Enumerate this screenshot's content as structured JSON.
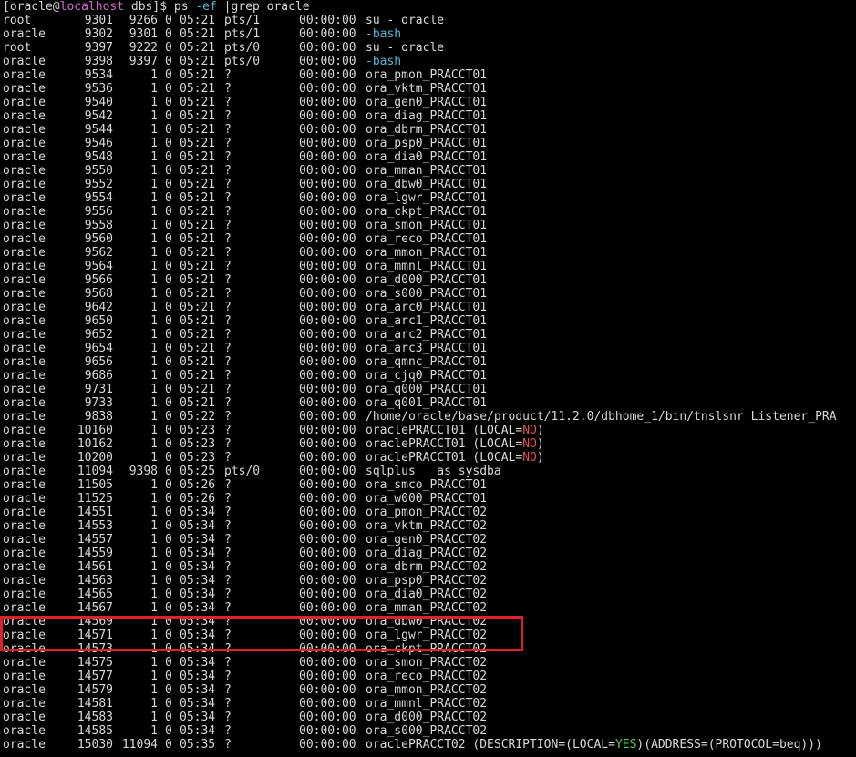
{
  "terminal": {
    "prompt": {
      "open": "[",
      "user": "oracle",
      "at": "@",
      "host": "localhost",
      "dir": " dbs]$ ",
      "cmd": "ps",
      "opt": " -ef",
      "rest": " |grep oracle"
    },
    "rows": [
      {
        "uid": "root",
        "pid": "9301",
        "ppid": "9266",
        "c": "0",
        "stime": "05:21",
        "tty": "pts/1",
        "time": "00:00:00",
        "cmd": "su - oracle"
      },
      {
        "uid": "oracle",
        "pid": "9302",
        "ppid": "9301",
        "c": "0",
        "stime": "05:21",
        "tty": "pts/1",
        "time": "00:00:00",
        "cmd": "-bash",
        "cmd_color": "bash"
      },
      {
        "uid": "root",
        "pid": "9397",
        "ppid": "9222",
        "c": "0",
        "stime": "05:21",
        "tty": "pts/0",
        "time": "00:00:00",
        "cmd": "su - oracle"
      },
      {
        "uid": "oracle",
        "pid": "9398",
        "ppid": "9397",
        "c": "0",
        "stime": "05:21",
        "tty": "pts/0",
        "time": "00:00:00",
        "cmd": "-bash",
        "cmd_color": "bash"
      },
      {
        "uid": "oracle",
        "pid": "9534",
        "ppid": "1",
        "c": "0",
        "stime": "05:21",
        "tty": "?",
        "time": "00:00:00",
        "cmd": "ora_pmon_PRACCT01"
      },
      {
        "uid": "oracle",
        "pid": "9536",
        "ppid": "1",
        "c": "0",
        "stime": "05:21",
        "tty": "?",
        "time": "00:00:00",
        "cmd": "ora_vktm_PRACCT01"
      },
      {
        "uid": "oracle",
        "pid": "9540",
        "ppid": "1",
        "c": "0",
        "stime": "05:21",
        "tty": "?",
        "time": "00:00:00",
        "cmd": "ora_gen0_PRACCT01"
      },
      {
        "uid": "oracle",
        "pid": "9542",
        "ppid": "1",
        "c": "0",
        "stime": "05:21",
        "tty": "?",
        "time": "00:00:00",
        "cmd": "ora_diag_PRACCT01"
      },
      {
        "uid": "oracle",
        "pid": "9544",
        "ppid": "1",
        "c": "0",
        "stime": "05:21",
        "tty": "?",
        "time": "00:00:00",
        "cmd": "ora_dbrm_PRACCT01"
      },
      {
        "uid": "oracle",
        "pid": "9546",
        "ppid": "1",
        "c": "0",
        "stime": "05:21",
        "tty": "?",
        "time": "00:00:00",
        "cmd": "ora_psp0_PRACCT01"
      },
      {
        "uid": "oracle",
        "pid": "9548",
        "ppid": "1",
        "c": "0",
        "stime": "05:21",
        "tty": "?",
        "time": "00:00:00",
        "cmd": "ora_dia0_PRACCT01"
      },
      {
        "uid": "oracle",
        "pid": "9550",
        "ppid": "1",
        "c": "0",
        "stime": "05:21",
        "tty": "?",
        "time": "00:00:00",
        "cmd": "ora_mman_PRACCT01"
      },
      {
        "uid": "oracle",
        "pid": "9552",
        "ppid": "1",
        "c": "0",
        "stime": "05:21",
        "tty": "?",
        "time": "00:00:00",
        "cmd": "ora_dbw0_PRACCT01"
      },
      {
        "uid": "oracle",
        "pid": "9554",
        "ppid": "1",
        "c": "0",
        "stime": "05:21",
        "tty": "?",
        "time": "00:00:00",
        "cmd": "ora_lgwr_PRACCT01"
      },
      {
        "uid": "oracle",
        "pid": "9556",
        "ppid": "1",
        "c": "0",
        "stime": "05:21",
        "tty": "?",
        "time": "00:00:00",
        "cmd": "ora_ckpt_PRACCT01"
      },
      {
        "uid": "oracle",
        "pid": "9558",
        "ppid": "1",
        "c": "0",
        "stime": "05:21",
        "tty": "?",
        "time": "00:00:00",
        "cmd": "ora_smon_PRACCT01"
      },
      {
        "uid": "oracle",
        "pid": "9560",
        "ppid": "1",
        "c": "0",
        "stime": "05:21",
        "tty": "?",
        "time": "00:00:00",
        "cmd": "ora_reco_PRACCT01"
      },
      {
        "uid": "oracle",
        "pid": "9562",
        "ppid": "1",
        "c": "0",
        "stime": "05:21",
        "tty": "?",
        "time": "00:00:00",
        "cmd": "ora_mmon_PRACCT01"
      },
      {
        "uid": "oracle",
        "pid": "9564",
        "ppid": "1",
        "c": "0",
        "stime": "05:21",
        "tty": "?",
        "time": "00:00:00",
        "cmd": "ora_mmnl_PRACCT01"
      },
      {
        "uid": "oracle",
        "pid": "9566",
        "ppid": "1",
        "c": "0",
        "stime": "05:21",
        "tty": "?",
        "time": "00:00:00",
        "cmd": "ora_d000_PRACCT01"
      },
      {
        "uid": "oracle",
        "pid": "9568",
        "ppid": "1",
        "c": "0",
        "stime": "05:21",
        "tty": "?",
        "time": "00:00:00",
        "cmd": "ora_s000_PRACCT01"
      },
      {
        "uid": "oracle",
        "pid": "9642",
        "ppid": "1",
        "c": "0",
        "stime": "05:21",
        "tty": "?",
        "time": "00:00:00",
        "cmd": "ora_arc0_PRACCT01"
      },
      {
        "uid": "oracle",
        "pid": "9650",
        "ppid": "1",
        "c": "0",
        "stime": "05:21",
        "tty": "?",
        "time": "00:00:00",
        "cmd": "ora_arc1_PRACCT01"
      },
      {
        "uid": "oracle",
        "pid": "9652",
        "ppid": "1",
        "c": "0",
        "stime": "05:21",
        "tty": "?",
        "time": "00:00:00",
        "cmd": "ora_arc2_PRACCT01"
      },
      {
        "uid": "oracle",
        "pid": "9654",
        "ppid": "1",
        "c": "0",
        "stime": "05:21",
        "tty": "?",
        "time": "00:00:00",
        "cmd": "ora_arc3_PRACCT01"
      },
      {
        "uid": "oracle",
        "pid": "9656",
        "ppid": "1",
        "c": "0",
        "stime": "05:21",
        "tty": "?",
        "time": "00:00:00",
        "cmd": "ora_qmnc_PRACCT01"
      },
      {
        "uid": "oracle",
        "pid": "9686",
        "ppid": "1",
        "c": "0",
        "stime": "05:21",
        "tty": "?",
        "time": "00:00:00",
        "cmd": "ora_cjq0_PRACCT01"
      },
      {
        "uid": "oracle",
        "pid": "9731",
        "ppid": "1",
        "c": "0",
        "stime": "05:21",
        "tty": "?",
        "time": "00:00:00",
        "cmd": "ora_q000_PRACCT01"
      },
      {
        "uid": "oracle",
        "pid": "9733",
        "ppid": "1",
        "c": "0",
        "stime": "05:21",
        "tty": "?",
        "time": "00:00:00",
        "cmd": "ora_q001_PRACCT01"
      },
      {
        "uid": "oracle",
        "pid": "9838",
        "ppid": "1",
        "c": "0",
        "stime": "05:22",
        "tty": "?",
        "time": "00:00:00",
        "cmd": "/home/oracle/base/product/11.2.0/dbhome_1/bin/tnslsnr Listener_PRA"
      },
      {
        "uid": "oracle",
        "pid": "10160",
        "ppid": "1",
        "c": "0",
        "stime": "05:23",
        "tty": "?",
        "time": "00:00:00",
        "cmd": "oraclePRACCT01 (LOCAL=",
        "cmd_mid": "NO",
        "cmd_mid_color": "no",
        "cmd_end": ")"
      },
      {
        "uid": "oracle",
        "pid": "10162",
        "ppid": "1",
        "c": "0",
        "stime": "05:23",
        "tty": "?",
        "time": "00:00:00",
        "cmd": "oraclePRACCT01 (LOCAL=",
        "cmd_mid": "NO",
        "cmd_mid_color": "no",
        "cmd_end": ")"
      },
      {
        "uid": "oracle",
        "pid": "10200",
        "ppid": "1",
        "c": "0",
        "stime": "05:23",
        "tty": "?",
        "time": "00:00:00",
        "cmd": "oraclePRACCT01 (LOCAL=",
        "cmd_mid": "NO",
        "cmd_mid_color": "no",
        "cmd_end": ")"
      },
      {
        "uid": "oracle",
        "pid": "11094",
        "ppid": "9398",
        "c": "0",
        "stime": "05:25",
        "tty": "pts/0",
        "time": "00:00:00",
        "cmd": "sqlplus   as sysdba"
      },
      {
        "uid": "oracle",
        "pid": "11505",
        "ppid": "1",
        "c": "0",
        "stime": "05:26",
        "tty": "?",
        "time": "00:00:00",
        "cmd": "ora_smco_PRACCT01"
      },
      {
        "uid": "oracle",
        "pid": "11525",
        "ppid": "1",
        "c": "0",
        "stime": "05:26",
        "tty": "?",
        "time": "00:00:00",
        "cmd": "ora_w000_PRACCT01"
      },
      {
        "uid": "oracle",
        "pid": "14551",
        "ppid": "1",
        "c": "0",
        "stime": "05:34",
        "tty": "?",
        "time": "00:00:00",
        "cmd": "ora_pmon_PRACCT02"
      },
      {
        "uid": "oracle",
        "pid": "14553",
        "ppid": "1",
        "c": "0",
        "stime": "05:34",
        "tty": "?",
        "time": "00:00:00",
        "cmd": "ora_vktm_PRACCT02"
      },
      {
        "uid": "oracle",
        "pid": "14557",
        "ppid": "1",
        "c": "0",
        "stime": "05:34",
        "tty": "?",
        "time": "00:00:00",
        "cmd": "ora_gen0_PRACCT02"
      },
      {
        "uid": "oracle",
        "pid": "14559",
        "ppid": "1",
        "c": "0",
        "stime": "05:34",
        "tty": "?",
        "time": "00:00:00",
        "cmd": "ora_diag_PRACCT02"
      },
      {
        "uid": "oracle",
        "pid": "14561",
        "ppid": "1",
        "c": "0",
        "stime": "05:34",
        "tty": "?",
        "time": "00:00:00",
        "cmd": "ora_dbrm_PRACCT02"
      },
      {
        "uid": "oracle",
        "pid": "14563",
        "ppid": "1",
        "c": "0",
        "stime": "05:34",
        "tty": "?",
        "time": "00:00:00",
        "cmd": "ora_psp0_PRACCT02"
      },
      {
        "uid": "oracle",
        "pid": "14565",
        "ppid": "1",
        "c": "0",
        "stime": "05:34",
        "tty": "?",
        "time": "00:00:00",
        "cmd": "ora_dia0_PRACCT02"
      },
      {
        "uid": "oracle",
        "pid": "14567",
        "ppid": "1",
        "c": "0",
        "stime": "05:34",
        "tty": "?",
        "time": "00:00:00",
        "cmd": "ora_mman_PRACCT02"
      },
      {
        "uid": "oracle",
        "pid": "14569",
        "ppid": "1",
        "c": "0",
        "stime": "05:34",
        "tty": "?",
        "time": "00:00:00",
        "cmd": "ora_dbw0_PRACCT02"
      },
      {
        "uid": "oracle",
        "pid": "14571",
        "ppid": "1",
        "c": "0",
        "stime": "05:34",
        "tty": "?",
        "time": "00:00:00",
        "cmd": "ora_lgwr_PRACCT02"
      },
      {
        "uid": "oracle",
        "pid": "14573",
        "ppid": "1",
        "c": "0",
        "stime": "05:34",
        "tty": "?",
        "time": "00:00:00",
        "cmd": "ora_ckpt_PRACCT02"
      },
      {
        "uid": "oracle",
        "pid": "14575",
        "ppid": "1",
        "c": "0",
        "stime": "05:34",
        "tty": "?",
        "time": "00:00:00",
        "cmd": "ora_smon_PRACCT02"
      },
      {
        "uid": "oracle",
        "pid": "14577",
        "ppid": "1",
        "c": "0",
        "stime": "05:34",
        "tty": "?",
        "time": "00:00:00",
        "cmd": "ora_reco_PRACCT02"
      },
      {
        "uid": "oracle",
        "pid": "14579",
        "ppid": "1",
        "c": "0",
        "stime": "05:34",
        "tty": "?",
        "time": "00:00:00",
        "cmd": "ora_mmon_PRACCT02"
      },
      {
        "uid": "oracle",
        "pid": "14581",
        "ppid": "1",
        "c": "0",
        "stime": "05:34",
        "tty": "?",
        "time": "00:00:00",
        "cmd": "ora_mmnl_PRACCT02"
      },
      {
        "uid": "oracle",
        "pid": "14583",
        "ppid": "1",
        "c": "0",
        "stime": "05:34",
        "tty": "?",
        "time": "00:00:00",
        "cmd": "ora_d000_PRACCT02"
      },
      {
        "uid": "oracle",
        "pid": "14585",
        "ppid": "1",
        "c": "0",
        "stime": "05:34",
        "tty": "?",
        "time": "00:00:00",
        "cmd": "ora_s000_PRACCT02"
      },
      {
        "uid": "oracle",
        "pid": "15030",
        "ppid": "11094",
        "c": "0",
        "stime": "05:35",
        "tty": "?",
        "time": "00:00:00",
        "cmd": "oraclePRACCT02 (DESCRIPTION=(LOCAL=",
        "cmd_mid": "YES",
        "cmd_mid_color": "yes",
        "cmd_end": ")(ADDRESS=(PROTOCOL=beq)))"
      }
    ],
    "colors": {
      "background": "#000000",
      "foreground": "#d8d8d8",
      "host": "#d36bd3",
      "option": "#56b6d6",
      "bash": "#56b6d6",
      "no": "#e05050",
      "yes": "#4fd14f",
      "highlight_box": "#e0202c"
    }
  }
}
